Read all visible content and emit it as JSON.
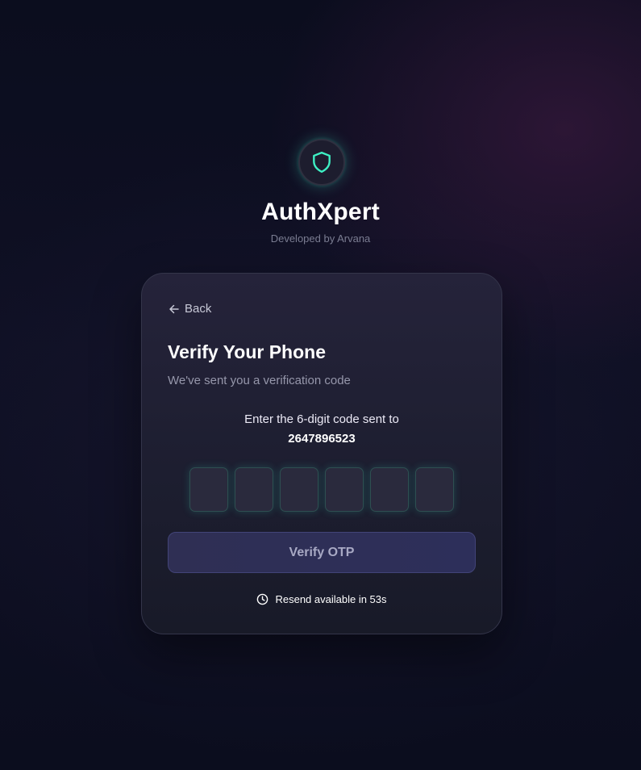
{
  "brand": {
    "title": "AuthXpert",
    "subtitle": "Developed by Arvana",
    "icon": "shield-icon",
    "accent_color": "#3ef0c4"
  },
  "card": {
    "back_label": "Back",
    "title": "Verify Your Phone",
    "subtitle": "We've sent you a verification code",
    "instruction": "Enter the 6-digit code sent to",
    "phone_number": "2647896523",
    "otp_digits": [
      "",
      "",
      "",
      "",
      "",
      ""
    ],
    "verify_label": "Verify OTP",
    "resend_text": "Resend available in 53s"
  },
  "colors": {
    "background": "#0b0d1e",
    "card": "#22213a",
    "button": "#2f2f54",
    "otp_glow": "#34d2b4"
  }
}
